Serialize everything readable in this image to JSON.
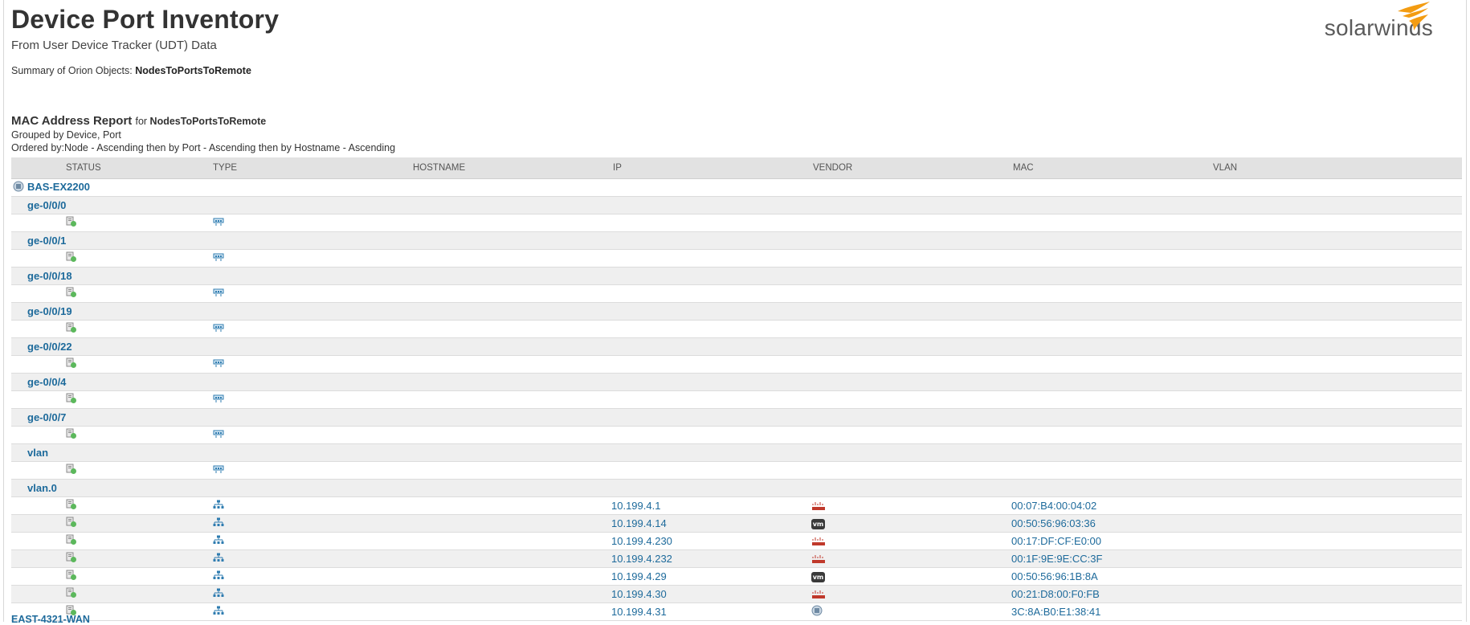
{
  "page": {
    "title": "Device Port Inventory",
    "subtitle": "From User Device Tracker (UDT) Data",
    "summary_label": "Summary of Orion Objects:",
    "summary_value": "NodesToPortsToRemote"
  },
  "logo": {
    "text": "solarwinds",
    "accent": "#f39c12",
    "icon": "solarwinds-bird-logo"
  },
  "report": {
    "title": "MAC Address Report",
    "for_label": "for",
    "for_value": "NodesToPortsToRemote",
    "grouped_by": "Grouped by Device, Port",
    "ordered_by": "Ordered by:Node - Ascending then by Port - Ascending then by Hostname - Ascending"
  },
  "columns": [
    "STATUS",
    "TYPE",
    "HOSTNAME",
    "IP",
    "VENDOR",
    "MAC",
    "VLAN"
  ],
  "device": {
    "name": "BAS-EX2200",
    "icon": "juniper-device-icon"
  },
  "ports": [
    {
      "name": "ge-0/0/0"
    },
    {
      "name": "ge-0/0/1"
    },
    {
      "name": "ge-0/0/18"
    },
    {
      "name": "ge-0/0/19"
    },
    {
      "name": "ge-0/0/22"
    },
    {
      "name": "ge-0/0/4"
    },
    {
      "name": "ge-0/0/7"
    },
    {
      "name": "vlan"
    },
    {
      "name": "vlan.0"
    }
  ],
  "vlan0_rows": [
    {
      "ip": "10.199.4.1",
      "vendor": "cisco",
      "mac": "00:07:B4:00:04:02"
    },
    {
      "ip": "10.199.4.14",
      "vendor": "vmware",
      "mac": "00:50:56:96:03:36"
    },
    {
      "ip": "10.199.4.230",
      "vendor": "cisco",
      "mac": "00:17:DF:CF:E0:00"
    },
    {
      "ip": "10.199.4.232",
      "vendor": "cisco",
      "mac": "00:1F:9E:9E:CC:3F"
    },
    {
      "ip": "10.199.4.29",
      "vendor": "vmware",
      "mac": "00:50:56:96:1B:8A"
    },
    {
      "ip": "10.199.4.30",
      "vendor": "cisco",
      "mac": "00:21:D8:00:F0:FB"
    },
    {
      "ip": "10.199.4.31",
      "vendor": "juniper",
      "mac": "3C:8A:B0:E1:38:41"
    }
  ],
  "next_device": "EAST-4321-WAN",
  "vendor_labels": {
    "vmware": "vm"
  },
  "colors": {
    "link": "#1d6a9b",
    "header_bg": "#e2e2e2",
    "row_alt": "#f0f0f0",
    "status_green": "#5cb85c"
  }
}
